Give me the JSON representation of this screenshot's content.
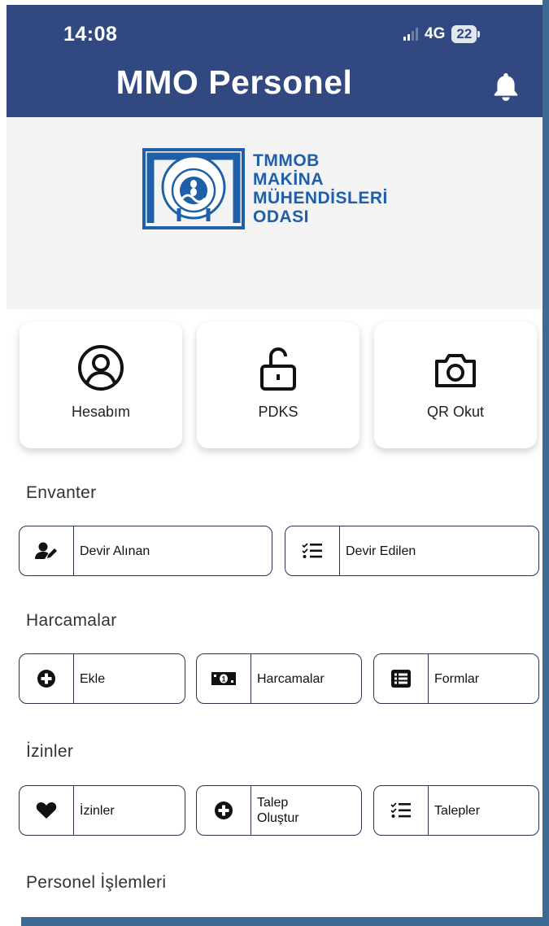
{
  "status_bar": {
    "time": "14:08",
    "network": "4G",
    "battery": "22"
  },
  "header": {
    "title": "MMO Personel",
    "bell_icon": "bell-icon"
  },
  "logo": {
    "lines": [
      "TMMOB",
      "MAKİNA",
      "MÜHENDİSLERİ",
      "ODASI"
    ],
    "emblem_text": "TMMOB MAKİNA MÜHENDİSLERİ ODASI"
  },
  "quick_actions": [
    {
      "label": "Hesabım",
      "icon": "user-circle-icon"
    },
    {
      "label": "PDKS",
      "icon": "unlock-icon"
    },
    {
      "label": "QR Okut",
      "icon": "camera-icon"
    }
  ],
  "sections": {
    "envanter": {
      "title": "Envanter",
      "buttons": [
        {
          "label": "Devir Alınan",
          "icon": "user-edit-icon"
        },
        {
          "label": "Devir Edilen",
          "icon": "checklist-icon"
        }
      ]
    },
    "harcamalar": {
      "title": "Harcamalar",
      "buttons": [
        {
          "label": "Ekle",
          "icon": "plus-circle-icon"
        },
        {
          "label": "Harcamalar",
          "icon": "money-bill-icon"
        },
        {
          "label": "Formlar",
          "icon": "list-alt-icon"
        }
      ]
    },
    "izinler": {
      "title": "İzinler",
      "buttons": [
        {
          "label": "İzinler",
          "icon": "heart-icon"
        },
        {
          "label": "Talep\nOluştur",
          "label_line1": "Talep",
          "label_line2": "Oluştur",
          "icon": "plus-circle-icon"
        },
        {
          "label": "Talepler",
          "icon": "checklist-icon"
        }
      ]
    },
    "personel": {
      "title": "Personel İşlemleri"
    }
  },
  "colors": {
    "header": "#314880",
    "logo_blue": "#1f5fa8",
    "frame": "#3c6a93",
    "button_border": "#2a3350"
  }
}
